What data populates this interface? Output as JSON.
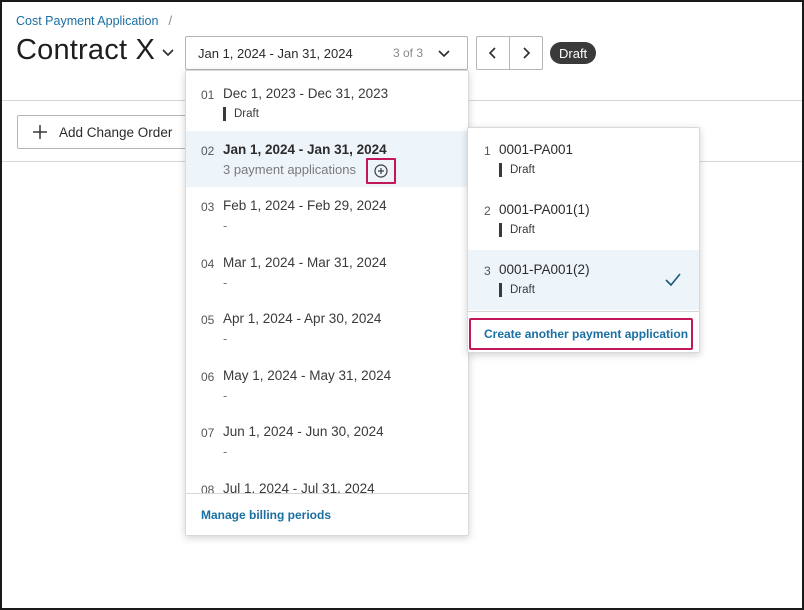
{
  "breadcrumb": {
    "parent": "Cost Payment Application",
    "separator": "/"
  },
  "header": {
    "title": "Contract X",
    "period_selector": {
      "value": "Jan 1, 2024 - Jan 31, 2024",
      "count": "3 of 3"
    },
    "status": "Draft"
  },
  "toolbar": {
    "add_change_order": "Add Change Order"
  },
  "period_menu": {
    "items": [
      {
        "num": "01",
        "range": "Dec 1, 2023 - Dec 31, 2023",
        "sub": "",
        "tag": "Draft"
      },
      {
        "num": "02",
        "range": "Jan 1, 2024 - Jan 31, 2024",
        "sub": "3 payment applications",
        "tag": ""
      },
      {
        "num": "03",
        "range": "Feb 1, 2024 - Feb 29, 2024",
        "sub": "-",
        "tag": ""
      },
      {
        "num": "04",
        "range": "Mar 1, 2024 - Mar 31, 2024",
        "sub": "-",
        "tag": ""
      },
      {
        "num": "05",
        "range": "Apr 1, 2024 - Apr 30, 2024",
        "sub": "-",
        "tag": ""
      },
      {
        "num": "06",
        "range": "May 1, 2024 - May 31, 2024",
        "sub": "-",
        "tag": ""
      },
      {
        "num": "07",
        "range": "Jun 1, 2024 - Jun 30, 2024",
        "sub": "-",
        "tag": ""
      },
      {
        "num": "08",
        "range": "Jul 1, 2024 - Jul 31, 2024",
        "sub": "",
        "tag": ""
      }
    ],
    "footer_link": "Manage billing periods"
  },
  "app_menu": {
    "items": [
      {
        "num": "1",
        "name": "0001-PA001",
        "tag": "Draft"
      },
      {
        "num": "2",
        "name": "0001-PA001(1)",
        "tag": "Draft"
      },
      {
        "num": "3",
        "name": "0001-PA001(2)",
        "tag": "Draft"
      }
    ],
    "create_label": "Create another payment application"
  },
  "colors": {
    "link": "#1a6fa3",
    "highlight_border": "#c2185b",
    "selected_bg": "#eef5fa",
    "status_pill_bg": "#3a3a3a",
    "check": "#1a5c78"
  },
  "icons": [
    "chevron-down-icon",
    "chevron-left-icon",
    "chevron-right-icon",
    "plus-icon",
    "add-circle-icon",
    "checkmark-icon"
  ]
}
